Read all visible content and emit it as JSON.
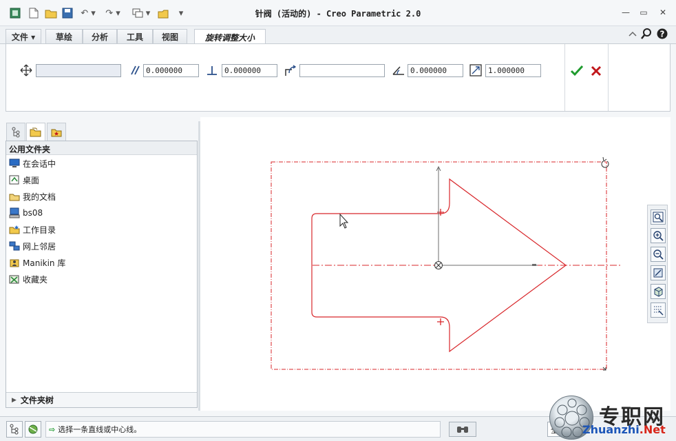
{
  "window": {
    "title": "针阀 (活动的) - Creo Parametric 2.0",
    "minimize_glyph": "—",
    "restore_glyph": "▭",
    "close_glyph": "✕"
  },
  "quick_access": {
    "icons": [
      "regenerate-icon",
      "new-file-icon",
      "open-folder-icon",
      "save-icon",
      "undo-icon",
      "redo-icon",
      "windows-icon",
      "close-window-icon",
      "customize-dropdown-icon"
    ]
  },
  "ribbon": {
    "tabs": [
      {
        "label": "文件 ▾"
      },
      {
        "label": "草绘"
      },
      {
        "label": "分析"
      },
      {
        "label": "工具"
      },
      {
        "label": "视图"
      },
      {
        "label": "旋转调整大小"
      }
    ],
    "active_tab": "旋转调整大小"
  },
  "dashboard": {
    "move_reference": "",
    "horizontal_value": "0.000000",
    "vertical_value": "0.000000",
    "rotation_reference": "",
    "angle_value": "0.000000",
    "scale_value": "1.000000"
  },
  "navigator": {
    "header": "公用文件夹",
    "items": [
      {
        "label": "在会话中",
        "icon": "monitor-icon"
      },
      {
        "label": "桌面",
        "icon": "desktop-icon"
      },
      {
        "label": "我的文档",
        "icon": "documents-folder-icon"
      },
      {
        "label": "bs08",
        "icon": "computer-icon"
      },
      {
        "label": "工作目录",
        "icon": "work-directory-icon"
      },
      {
        "label": "网上邻居",
        "icon": "network-icon"
      },
      {
        "label": "Manikin 库",
        "icon": "manikin-library-icon"
      },
      {
        "label": "收藏夹",
        "icon": "favorites-icon"
      }
    ],
    "footer": "文件夹树"
  },
  "status": {
    "message": "选择一条直线或中心线。",
    "filter_value": "全部"
  },
  "watermark": {
    "cn": "专职网",
    "en_main": "Zhuanzhi",
    "en_suffix": ".Net"
  },
  "colors": {
    "sketch": "#d8262a",
    "axis": "#6b6b6b",
    "ok": "#1f9b2e",
    "cancel": "#c1171b"
  }
}
